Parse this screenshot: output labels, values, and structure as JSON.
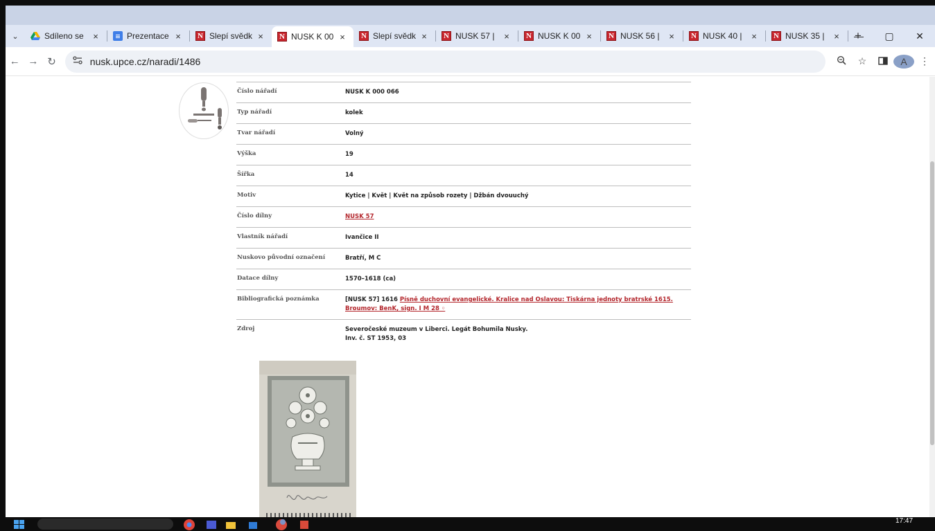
{
  "browser": {
    "tabs": [
      {
        "label": "Sdíleno se",
        "favicon": "google-drive-icon",
        "active": false
      },
      {
        "label": "Prezentace",
        "favicon": "google-slides-icon",
        "active": false
      },
      {
        "label": "Slepí svědk",
        "favicon": "nusk-favicon",
        "active": false
      },
      {
        "label": "NUSK K 00",
        "favicon": "nusk-favicon",
        "active": true
      },
      {
        "label": "Slepí svědk",
        "favicon": "nusk-favicon",
        "active": false
      },
      {
        "label": "NUSK 57 |",
        "favicon": "nusk-favicon",
        "active": false
      },
      {
        "label": "NUSK K 00",
        "favicon": "nusk-favicon",
        "active": false
      },
      {
        "label": "NUSK 56 |",
        "favicon": "nusk-favicon",
        "active": false
      },
      {
        "label": "NUSK 40 |",
        "favicon": "nusk-favicon",
        "active": false
      },
      {
        "label": "NUSK 35 |",
        "favicon": "nusk-favicon",
        "active": false
      }
    ],
    "tab_close_glyph": "×",
    "favicon_letter": "N",
    "new_tab_glyph": "+",
    "url": "nusk.upce.cz/naradi/1486",
    "avatar_letter": "A",
    "window_controls": [
      "—",
      "▢",
      "✕"
    ]
  },
  "detail": {
    "rows": [
      {
        "key": "Číslo nářadí",
        "value": "NUSK K 000 066"
      },
      {
        "key": "Typ nářadí",
        "value": "kolek"
      },
      {
        "key": "Tvar nářadí",
        "value": "Volný"
      },
      {
        "key": "Výška",
        "value": "19"
      },
      {
        "key": "Šířka",
        "value": "14"
      },
      {
        "key": "Motiv",
        "value": "Kytice | Květ | Květ na způsob rozety | Džbán dvouuchý"
      },
      {
        "key": "Číslo dílny",
        "value": "NUSK 57",
        "link": true
      },
      {
        "key": "Vlastník nářadí",
        "value": "Ivančice II"
      },
      {
        "key": "Nuskovo původní označení",
        "value": "Bratří, M C"
      },
      {
        "key": "Datace dílny",
        "value": "1570–1618 (ca)"
      },
      {
        "key": "Bibliografická poznámka",
        "value_prefix": "[NUSK 57] 1616 ",
        "value_link": "Písně duchovní evangelické. Kralice nad Oslavou: Tiskárna jednoty bratrské 1615. Broumov: BenK, sign. I M 28 ◦"
      },
      {
        "key": "Zdroj",
        "value_line1": "Severočeské muzeum v Liberci. Legát Bohumila Nusky.",
        "value_line2": "Inv. č. ST 1953, 03"
      }
    ]
  },
  "scan": {
    "signature": "Kralice"
  },
  "taskbar": {
    "time": "17:47"
  },
  "colors": {
    "link": "#b3262c",
    "tabbar": "#dfe6f4",
    "favicon_red": "#c8262e"
  }
}
